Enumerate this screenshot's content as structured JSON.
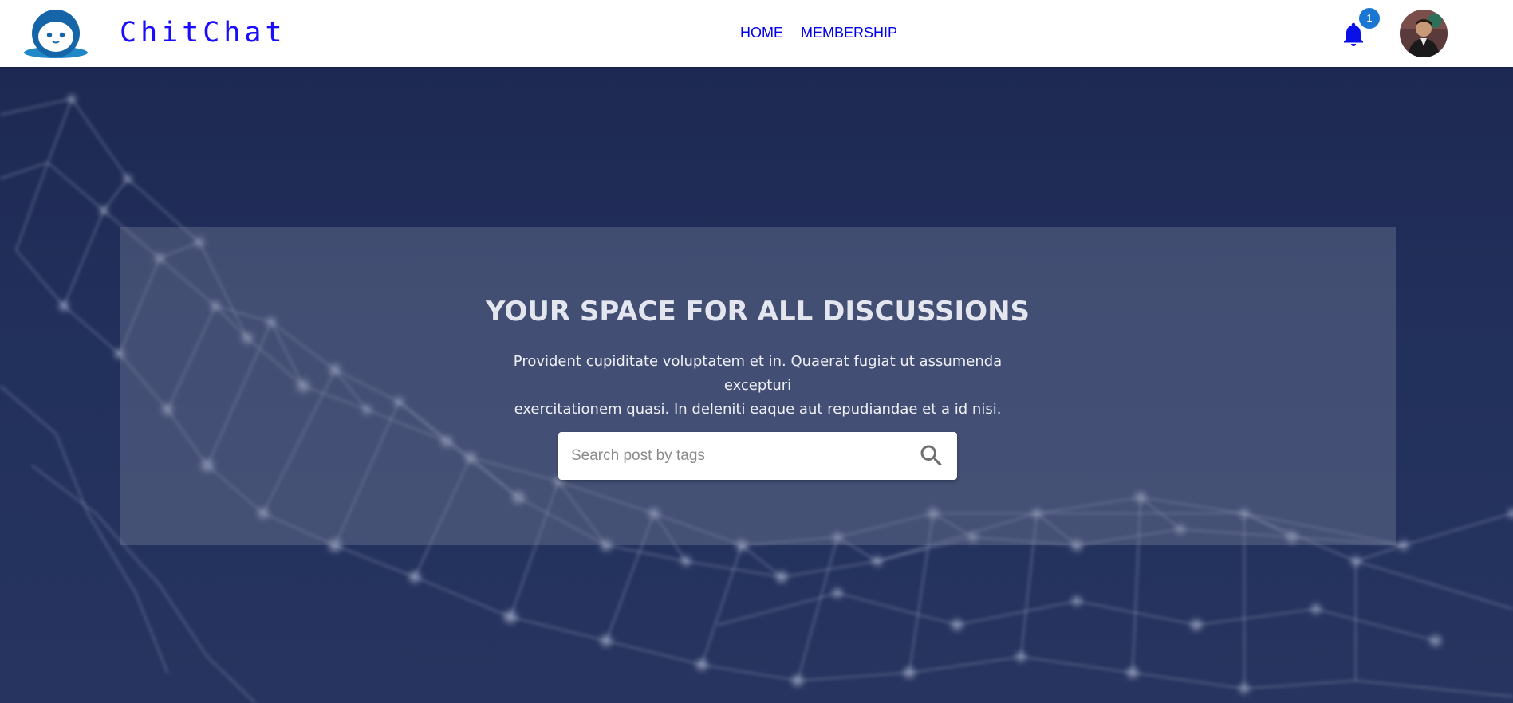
{
  "header": {
    "brand": "ChitChat",
    "nav": [
      {
        "label": "HOME"
      },
      {
        "label": "MEMBERSHIP"
      }
    ],
    "notifications": {
      "icon": "bell-icon",
      "count": "1",
      "badge_color": "#1976d2"
    },
    "avatar": {
      "icon": "user-avatar"
    }
  },
  "hero": {
    "title": "YOUR SPACE FOR ALL DISCUSSIONS",
    "subtitle_line1": "Provident cupiditate voluptatem et in. Quaerat fugiat ut assumenda excepturi",
    "subtitle_line2": "exercitationem quasi. In deleniti eaque aut repudiandae et a id nisi.",
    "search": {
      "placeholder": "Search post by tags",
      "value": "",
      "icon": "search-icon"
    }
  },
  "colors": {
    "brand": "#1a0dff",
    "nav_link": "#0000ee",
    "hero_bg": "#1d2952"
  }
}
